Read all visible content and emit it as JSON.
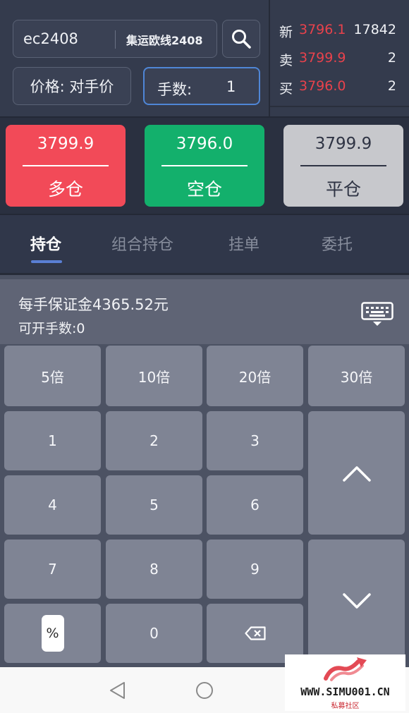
{
  "order_panel": {
    "symbol_code": "ec2408",
    "symbol_name": "集运欧线2408",
    "price_mode": "价格: 对手价",
    "lots_label": "手数:",
    "lots_value": "1"
  },
  "quotes": [
    {
      "label": "新",
      "price": "3796.1",
      "volume": "17842"
    },
    {
      "label": "卖",
      "price": "3799.9",
      "volume": "2"
    },
    {
      "label": "买",
      "price": "3796.0",
      "volume": "2"
    }
  ],
  "trade_buttons": {
    "long": {
      "price": "3799.9",
      "label": "多仓"
    },
    "short": {
      "price": "3796.0",
      "label": "空仓"
    },
    "close": {
      "price": "3799.9",
      "label": "平仓"
    }
  },
  "tabs": [
    "持仓",
    "组合持仓",
    "挂单",
    "委托"
  ],
  "active_tab": "持仓",
  "keyboard_info": {
    "margin_text": "每手保证金4365.52元",
    "openable_text": "可开手数:0"
  },
  "keypad": {
    "multipliers": [
      "5倍",
      "10倍",
      "20倍",
      "30倍"
    ],
    "digits": [
      "1",
      "2",
      "3",
      "4",
      "5",
      "6",
      "7",
      "8",
      "9",
      "0"
    ],
    "percent": "%"
  },
  "watermark": {
    "site": "WWW.SIMU001.CN",
    "subtitle": "私募社区"
  },
  "colors": {
    "long": "#f24a58",
    "short": "#13b06c",
    "close": "#c7c8cc",
    "quote_price": "#e8424c",
    "tab_underline": "#5a7fd4"
  }
}
